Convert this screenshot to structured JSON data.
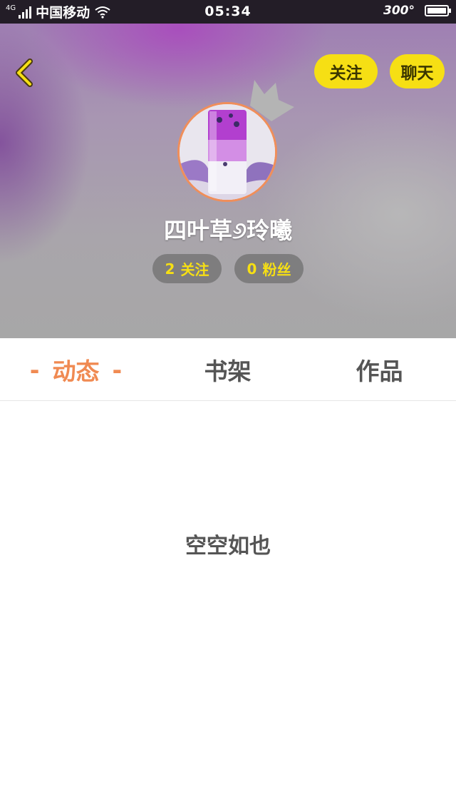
{
  "status_bar": {
    "network": "4G",
    "carrier": "中国移动",
    "time": "05:34",
    "battery_text": "300°",
    "battery_icon": "battery-icon",
    "wifi_icon": "wifi-icon",
    "signal_icon": "signal-icon"
  },
  "header": {
    "back_icon": "chevron-left-icon",
    "follow_label": "关注",
    "chat_label": "聊天",
    "username": "四叶草୬玲曦",
    "following_count": "2",
    "following_label": "关注",
    "fans_count": "0",
    "fans_label": "粉丝",
    "accent_color": "#f6df14"
  },
  "tabs": [
    {
      "label": "动态",
      "active": true
    },
    {
      "label": "书架",
      "active": false
    },
    {
      "label": "作品",
      "active": false
    }
  ],
  "tab_active_color": "#f08a52",
  "tab_dash": "-",
  "empty_state": {
    "text": "空空如也"
  }
}
